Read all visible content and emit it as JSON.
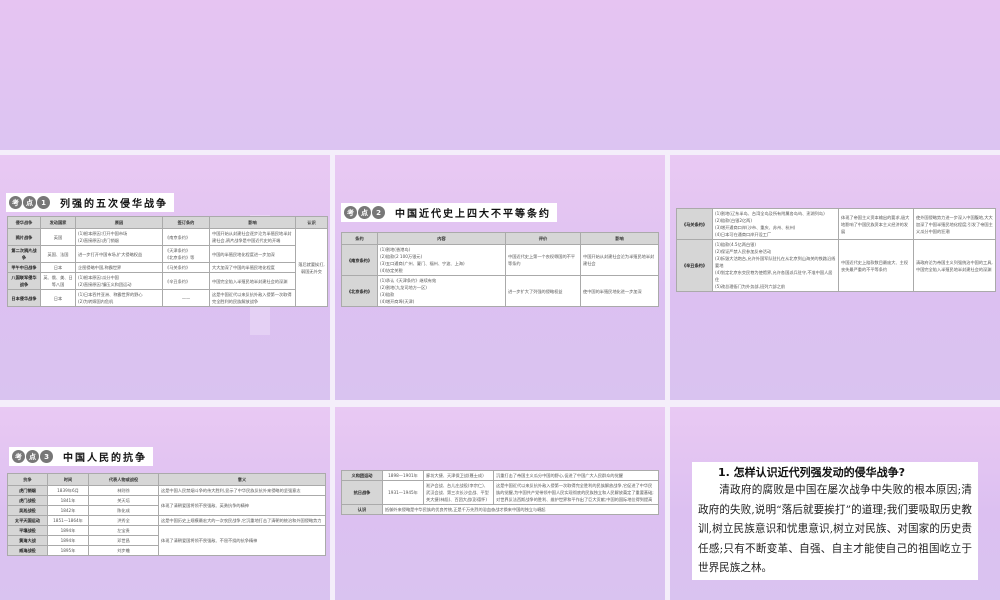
{
  "slides": [
    {
      "badge": [
        "考",
        "点",
        "1"
      ],
      "title": "列强的五次侵华战争",
      "table": {
        "header": [
          "侵华战争",
          "发动国家",
          "原因",
          "签订条约",
          "影响",
          "认识"
        ],
        "rows": [
          [
            {
              "t": "鸦片战争",
              "f": 1
            },
            {
              "t": "英国",
              "c": 1
            },
            "(1)根本原因:打开中国市场\n(2)直接原因:虎门销烟",
            {
              "t": "《南京条约》"
            },
            "中国开始从封建社会逐步沦为半殖民地半封建社会,鸦片战争是中国近代史的开端",
            {
              "t": "落后就要挨打,弱国无外交",
              "rs": 5,
              "c": 1
            }
          ],
          [
            {
              "t": "第二次鸦片战争",
              "f": 1
            },
            {
              "t": "英国、法国",
              "c": 1
            },
            "进一步打开中国市场,扩大侵略权益",
            "《天津条约》\n《北京条约》等",
            "中国的半殖民地化程度进一步加深"
          ],
          [
            {
              "t": "甲午中日战争",
              "f": 1
            },
            {
              "t": "日本",
              "c": 1
            },
            "企图侵略中国,称霸世界",
            "《马关条约》",
            "大大加深了中国的半殖民地化程度"
          ],
          [
            {
              "t": "八国联军侵华战争",
              "f": 1
            },
            {
              "t": "英、俄、美、日等八国",
              "c": 1
            },
            "(1)根本原因:瓜分中国\n(2)直接原因:镇压义和团运动",
            "《辛丑条约》",
            "中国完全陷入半殖民地半封建社会的深渊"
          ],
          [
            {
              "t": "日本侵华战争",
              "f": 1
            },
            {
              "t": "日本",
              "c": 1
            },
            "(1)日本吞并亚洲、称霸世界的野心\n(2)为转嫁国内危机",
            {
              "t": "——",
              "c": 1
            },
            "这是中国近代以来反抗外敌入侵第一次取得完全胜利的民族解放战争"
          ]
        ]
      }
    },
    {
      "badge": [
        "考",
        "点",
        "2"
      ],
      "title": "中国近代史上四大不平等条约",
      "table": {
        "header": [
          "条约",
          "内容",
          "评价",
          "影响"
        ],
        "rows": [
          [
            {
              "t": "《南京条约》",
              "f": 1
            },
            "(1)割地(香港岛)\n(2)赔款(2 100万银元)\n(3)五口通商(广州、厦门、福州、宁波、上海)\n(4)协定关税",
            "中国近代史上第一个丧权辱国的不平等条约",
            "中国开始从封建社会沦为半殖民地半封建社会"
          ],
          [
            {
              "t": "《北京条约》",
              "f": 1
            },
            "(1)承认《天津条约》继续有效\n(2)割地(九龙司地方一区)\n(3)赔款\n(4)增开商埠(天津)",
            "进一步扩大了列强的侵略权益",
            "使中国的半殖民地化进一步加深"
          ]
        ]
      }
    },
    {
      "table": {
        "rows": [
          [
            {
              "t": "《马关条约》",
              "f": 1
            },
            "(1)割地(辽东半岛、台湾全岛及所有附属各岛屿、澎湖列岛)\n(2)赔款(白银2亿两)\n(3)增开通商口岸(沙市、重庆、苏州、杭州)\n(4)日本可在通商口岸开设工厂",
            "体现了帝国主义资本输出的要求,极大地影响了中国民族资本主义经济的发展",
            "使外国侵略势力进一步深入中国腹地,大大加深了中国半殖民地化程度;引发了帝国主义瓜分中国的狂潮"
          ],
          [
            {
              "t": "《辛丑条约》",
              "f": 1
            },
            "(1)赔款(4.5亿两白银)\n(2)保证严禁人民参加反帝活动\n(3)拆毁大沽炮台,允许外国军队驻扎在从北京到山海关的铁路沿线要地\n(4)划定北京东交民巷为使馆界,允许各国派兵驻守,不准中国人居住\n(5)改总理衙门为外务部,班列六部之前",
            "中国近代史上赔款数目最庞大、主权丧失最严重的不平等条约",
            "清政府沦为帝国主义列强统治中国的工具,中国完全陷入半殖民地半封建社会的深渊"
          ]
        ]
      }
    },
    {
      "badge": [
        "考",
        "点",
        "3"
      ],
      "title": "中国人民的抗争",
      "table": {
        "header": [
          "抗争",
          "时间",
          "代表人物或战役",
          "意义"
        ],
        "rows": [
          [
            {
              "t": "虎门销烟",
              "f": 1
            },
            {
              "t": "1839年6月",
              "c": 1
            },
            {
              "t": "林则徐",
              "c": 1
            },
            "这是中国人民禁烟斗争的伟大胜利,显示了中华民族反抗外来侵略的坚强意志"
          ],
          [
            {
              "t": "虎门战役",
              "f": 1
            },
            {
              "t": "1841年",
              "c": 1
            },
            {
              "t": "关天培",
              "c": 1
            },
            {
              "t": "体现了清朝爱国将领不畏强敌、英勇抗争的精神",
              "rs": 2
            }
          ],
          [
            {
              "t": "吴淞战役",
              "f": 1
            },
            {
              "t": "1842年",
              "c": 1
            },
            {
              "t": "陈化成",
              "c": 1
            }
          ],
          [
            {
              "t": "太平天国运动",
              "f": 1
            },
            {
              "t": "1851—1864年",
              "c": 1
            },
            {
              "t": "洪秀全",
              "c": 1
            },
            "这是中国历史上规模最宏大的一次农民战争,它沉重地打击了清朝的统治和外国侵略势力"
          ],
          [
            {
              "t": "平壤战役",
              "f": 1
            },
            {
              "t": "1894年",
              "c": 1
            },
            {
              "t": "左宝贵",
              "c": 1
            },
            {
              "t": "体现了清朝爱国将领不畏强敌、不屈不挠的抗争精神",
              "rs": 3
            }
          ],
          [
            {
              "t": "黄海大战",
              "f": 1
            },
            {
              "t": "1894年",
              "c": 1
            },
            {
              "t": "邓世昌",
              "c": 1
            }
          ],
          [
            {
              "t": "威海战役",
              "f": 1
            },
            {
              "t": "1895年",
              "c": 1
            },
            {
              "t": "刘步蟾",
              "c": 1
            }
          ]
        ]
      }
    },
    {
      "table": {
        "rows": [
          [
            {
              "t": "义和团运动",
              "f": 1
            },
            {
              "t": "1898—1901年",
              "c": 1
            },
            "廊坊大捷、天津保卫战(聂士成)",
            "沉重打击了帝国主义瓜分中国的野心,促进了中国广大人民群众的觉醒"
          ],
          [
            {
              "t": "抗日战争",
              "f": 1
            },
            {
              "t": "1931—1945年",
              "c": 1
            },
            "淞沪会战、台儿庄战役(李宗仁)、武汉会战、第三次长沙会战、平型关大捷(林彪)、百团大战(彭德怀)",
            "这是中国近代以来反抗外敌入侵第一次取得完全胜利的民族解放战争,它促进了中华民族的觉醒,为中国共产党带领中国人民实现彻底的民族独立和人民解放奠定了重要基础;对世界反法西斯战争的胜利、维护世界和平作出了巨大贡献;中国的国际地位得到提高"
          ],
          [
            {
              "t": "认识",
              "f": 1
            },
            {
              "t": "抵御外来侵略是中华民族的优良传统,正是千万先烈的浴血奋战才换来中国的独立与崛起",
              "cs": 3
            }
          ]
        ]
      }
    },
    {
      "question": "1. 怎样认识近代列强发动的侵华战争?",
      "answer": "清政府的腐败是中国在屡次战争中失败的根本原因;清政府的失败,说明“落后就要挨打”的道理;我们要吸取历史教训,树立民族意识和忧患意识,树立对民族、对国家的历史责任感;只有不断变革、自强、自主才能使自己的祖国屹立于世界民族之林。"
    }
  ]
}
